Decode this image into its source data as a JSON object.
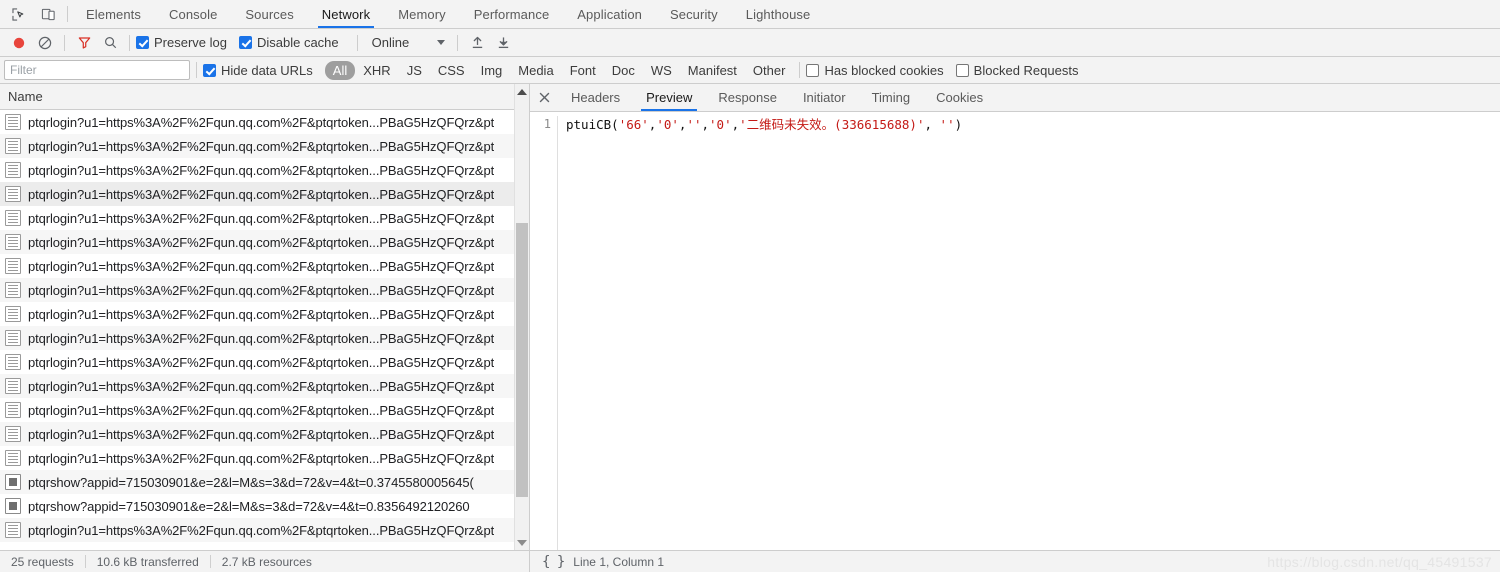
{
  "toolbar_top": {
    "inspect_icon": "inspect-element-icon",
    "device_icon": "device-toolbar-icon",
    "tabs": [
      {
        "label": "Elements",
        "active": false
      },
      {
        "label": "Console",
        "active": false
      },
      {
        "label": "Sources",
        "active": false
      },
      {
        "label": "Network",
        "active": true
      },
      {
        "label": "Memory",
        "active": false
      },
      {
        "label": "Performance",
        "active": false
      },
      {
        "label": "Application",
        "active": false
      },
      {
        "label": "Security",
        "active": false
      },
      {
        "label": "Lighthouse",
        "active": false
      }
    ]
  },
  "network_toolbar": {
    "record_icon": "record-stop-icon",
    "clear_icon": "clear-icon",
    "filter_icon": "filter-icon",
    "search_icon": "search-icon",
    "preserve_log": {
      "label": "Preserve log",
      "checked": true
    },
    "disable_cache": {
      "label": "Disable cache",
      "checked": true
    },
    "throttle_value": "Online",
    "import_icon": "import-har-icon",
    "export_icon": "export-har-icon",
    "accent_color": "#1a73e8",
    "record_color": "#e8453c",
    "filter_active_color": "#d93025"
  },
  "filter_bar": {
    "filter_placeholder": "Filter",
    "filter_value": "",
    "hide_data_urls": {
      "label": "Hide data URLs",
      "checked": true
    },
    "types": [
      {
        "label": "All",
        "selected": true
      },
      {
        "label": "XHR",
        "selected": false
      },
      {
        "label": "JS",
        "selected": false
      },
      {
        "label": "CSS",
        "selected": false
      },
      {
        "label": "Img",
        "selected": false
      },
      {
        "label": "Media",
        "selected": false
      },
      {
        "label": "Font",
        "selected": false
      },
      {
        "label": "Doc",
        "selected": false
      },
      {
        "label": "WS",
        "selected": false
      },
      {
        "label": "Manifest",
        "selected": false
      },
      {
        "label": "Other",
        "selected": false
      }
    ],
    "has_blocked_cookies": {
      "label": "Has blocked cookies",
      "checked": false
    },
    "blocked_requests": {
      "label": "Blocked Requests",
      "checked": false
    }
  },
  "request_list": {
    "column_header": "Name",
    "rows": [
      {
        "name": "ptqrlogin?u1=https%3A%2F%2Fqun.qq.com%2F&ptqrtoken...PBaG5HzQFQrz&pt",
        "icon": "document-icon",
        "selected": false
      },
      {
        "name": "ptqrlogin?u1=https%3A%2F%2Fqun.qq.com%2F&ptqrtoken...PBaG5HzQFQrz&pt",
        "icon": "document-icon",
        "selected": false
      },
      {
        "name": "ptqrlogin?u1=https%3A%2F%2Fqun.qq.com%2F&ptqrtoken...PBaG5HzQFQrz&pt",
        "icon": "document-icon",
        "selected": false
      },
      {
        "name": "ptqrlogin?u1=https%3A%2F%2Fqun.qq.com%2F&ptqrtoken...PBaG5HzQFQrz&pt",
        "icon": "document-icon",
        "selected": true
      },
      {
        "name": "ptqrlogin?u1=https%3A%2F%2Fqun.qq.com%2F&ptqrtoken...PBaG5HzQFQrz&pt",
        "icon": "document-icon",
        "selected": false
      },
      {
        "name": "ptqrlogin?u1=https%3A%2F%2Fqun.qq.com%2F&ptqrtoken...PBaG5HzQFQrz&pt",
        "icon": "document-icon",
        "selected": false
      },
      {
        "name": "ptqrlogin?u1=https%3A%2F%2Fqun.qq.com%2F&ptqrtoken...PBaG5HzQFQrz&pt",
        "icon": "document-icon",
        "selected": false
      },
      {
        "name": "ptqrlogin?u1=https%3A%2F%2Fqun.qq.com%2F&ptqrtoken...PBaG5HzQFQrz&pt",
        "icon": "document-icon",
        "selected": false
      },
      {
        "name": "ptqrlogin?u1=https%3A%2F%2Fqun.qq.com%2F&ptqrtoken...PBaG5HzQFQrz&pt",
        "icon": "document-icon",
        "selected": false
      },
      {
        "name": "ptqrlogin?u1=https%3A%2F%2Fqun.qq.com%2F&ptqrtoken...PBaG5HzQFQrz&pt",
        "icon": "document-icon",
        "selected": false
      },
      {
        "name": "ptqrlogin?u1=https%3A%2F%2Fqun.qq.com%2F&ptqrtoken...PBaG5HzQFQrz&pt",
        "icon": "document-icon",
        "selected": false
      },
      {
        "name": "ptqrlogin?u1=https%3A%2F%2Fqun.qq.com%2F&ptqrtoken...PBaG5HzQFQrz&pt",
        "icon": "document-icon",
        "selected": false
      },
      {
        "name": "ptqrlogin?u1=https%3A%2F%2Fqun.qq.com%2F&ptqrtoken...PBaG5HzQFQrz&pt",
        "icon": "document-icon",
        "selected": false
      },
      {
        "name": "ptqrlogin?u1=https%3A%2F%2Fqun.qq.com%2F&ptqrtoken...PBaG5HzQFQrz&pt",
        "icon": "document-icon",
        "selected": false
      },
      {
        "name": "ptqrlogin?u1=https%3A%2F%2Fqun.qq.com%2F&ptqrtoken...PBaG5HzQFQrz&pt",
        "icon": "document-icon",
        "selected": false
      },
      {
        "name": "ptqrshow?appid=715030901&e=2&l=M&s=3&d=72&v=4&t=0.3745580005645(",
        "icon": "image-icon",
        "selected": false
      },
      {
        "name": "ptqrshow?appid=715030901&e=2&l=M&s=3&d=72&v=4&t=0.8356492120260",
        "icon": "image-icon",
        "selected": false
      },
      {
        "name": "ptqrlogin?u1=https%3A%2F%2Fqun.qq.com%2F&ptqrtoken...PBaG5HzQFQrz&pt",
        "icon": "document-icon",
        "selected": false
      }
    ]
  },
  "detail_pane": {
    "close_icon": "close-icon",
    "tabs": [
      {
        "label": "Headers",
        "active": false
      },
      {
        "label": "Preview",
        "active": true
      },
      {
        "label": "Response",
        "active": false
      },
      {
        "label": "Initiator",
        "active": false
      },
      {
        "label": "Timing",
        "active": false
      },
      {
        "label": "Cookies",
        "active": false
      }
    ],
    "preview": {
      "line_number": "1",
      "tokens": [
        {
          "text": "ptuiCB(",
          "type": "fn"
        },
        {
          "text": "'66'",
          "type": "str"
        },
        {
          "text": ",",
          "type": "punct"
        },
        {
          "text": "'0'",
          "type": "str"
        },
        {
          "text": ",",
          "type": "punct"
        },
        {
          "text": "''",
          "type": "str"
        },
        {
          "text": ",",
          "type": "punct"
        },
        {
          "text": "'0'",
          "type": "str"
        },
        {
          "text": ",",
          "type": "punct"
        },
        {
          "text": "'二维码未失效。(336615688)'",
          "type": "str"
        },
        {
          "text": ", ",
          "type": "punct"
        },
        {
          "text": "''",
          "type": "str"
        },
        {
          "text": ")",
          "type": "punct"
        }
      ],
      "raw_text": "ptuiCB('66','0','','0','二维码未失效。(336615688)', '')"
    }
  },
  "status_bar": {
    "requests": "25 requests",
    "transferred": "10.6 kB transferred",
    "resources": "2.7 kB resources",
    "pretty_print_icon": "pretty-print-braces-icon",
    "cursor_position": "Line 1, Column 1"
  },
  "watermark": "https://blog.csdn.net/qq_45491537"
}
